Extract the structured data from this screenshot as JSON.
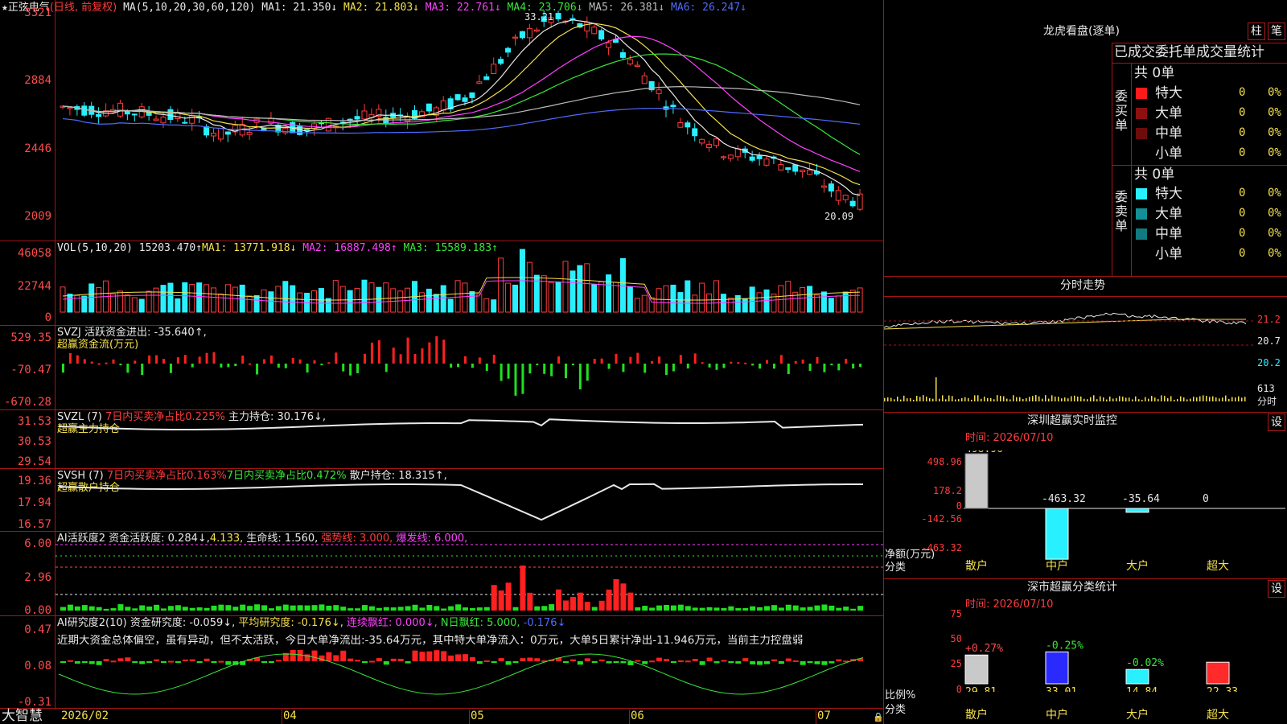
{
  "main": {
    "stock_name": "正弦电气",
    "period": "(日线, 前复权)",
    "ma_label": "MA(5,10,20,30,60,120)",
    "ma": [
      {
        "name": "MA1:",
        "value": "21.350↓",
        "color": "#e8e8e8"
      },
      {
        "name": "MA2:",
        "value": "21.803↓",
        "color": "#f5e04a"
      },
      {
        "name": "MA3:",
        "value": "22.761↓",
        "color": "#ff40ff"
      },
      {
        "name": "MA4:",
        "value": "23.706↓",
        "color": "#39e639"
      },
      {
        "name": "MA5:",
        "value": "26.381↓",
        "color": "#bbbbbb"
      },
      {
        "name": "MA6:",
        "value": "26.247↓",
        "color": "#4f6bff"
      }
    ],
    "y_ticks": [
      "3321",
      "2884",
      "2446",
      "2009"
    ],
    "high_label": "33.21",
    "low_label": "20.09"
  },
  "vol": {
    "label": "VOL(5,10,20)",
    "value": "15203.470↑",
    "ma1": "MA1: 13771.918↓",
    "ma2": "MA2: 16887.498↑",
    "ma3": "MA3: 15589.183↑",
    "y_ticks": [
      "46058",
      "22744",
      "0"
    ]
  },
  "svzj": {
    "label": "SVZJ  活跃资金进出: -35.640↑,",
    "sub": "超赢资金流(万元)",
    "y_ticks": [
      "529.35",
      "-70.47",
      "-670.28"
    ]
  },
  "svzl": {
    "label": "SVZL (7)",
    "ratio": "7日内买卖净占比0.225%",
    "hold": "主力持仓: 30.176↓,",
    "sub": "超赢主力持仓",
    "y_ticks": [
      "31.53",
      "30.53",
      "29.54"
    ]
  },
  "svsh": {
    "label": "SVSH (7)",
    "ratio1": "7日内买卖净占比0.163%",
    "ratio2": "7日内买卖净占比0.472%",
    "hold": "散户持仓: 18.315↑,",
    "sub": "超赢散户持仓",
    "y_ticks": [
      "19.36",
      "17.94",
      "16.57"
    ]
  },
  "ai1": {
    "label": "AI活跃度2",
    "v1": "资金活跃度: 0.284↓,",
    "v2": "4.133,",
    "v3": "生命线: 1.560,",
    "v4": "强势线: 3.000,",
    "v5": "爆发线: 6.000,",
    "y_ticks": [
      "6.00",
      "2.96",
      "0.00"
    ]
  },
  "ai2": {
    "label": "AI研究度2(10)",
    "v1": "资金研究度: -0.059↓,",
    "v2": "平均研究度: -0.176↓,",
    "v3": "连续飘红: 0.000↓,",
    "v4": "N日飘红: 5.000,",
    "v5": "-0.176↓",
    "comment": "近期大资金总体偏空，虽有异动，但不太活跃，今日大单净流出:-35.64万元，其中特大单净流入：0万元，大单5日累计净出-11.946万元，当前主力控盘弱",
    "y_ticks": [
      "0.47",
      "0.08",
      "-0.31"
    ]
  },
  "xaxis": {
    "brand": "大智慧",
    "labels": [
      "2026/02",
      "04",
      "05",
      "06",
      "07"
    ]
  },
  "right": {
    "dragon_title": "龙虎看盘(逐单)",
    "btn_zhu": "柱",
    "btn_bi": "笔",
    "tabs_title": "已成交委托单成交量统计",
    "buy_side": "委买单",
    "sell_side": "委卖单",
    "buy_total": "共 0单",
    "sell_total": "共 0单",
    "buy_rows": [
      {
        "label": "特大",
        "count": "0",
        "pct": "0%",
        "color": "#ff1a1a"
      },
      {
        "label": "大单",
        "count": "0",
        "pct": "0%",
        "color": "#8c1010"
      },
      {
        "label": "中单",
        "count": "0",
        "pct": "0%",
        "color": "#6e0c0c"
      },
      {
        "label": "小单",
        "count": "0",
        "pct": "0%",
        "color": "#000000"
      }
    ],
    "sell_rows": [
      {
        "label": "特大",
        "count": "0",
        "pct": "0%",
        "color": "#29f0ff"
      },
      {
        "label": "大单",
        "count": "0",
        "pct": "0%",
        "color": "#138f96"
      },
      {
        "label": "中单",
        "count": "0",
        "pct": "0%",
        "color": "#0f7a80"
      },
      {
        "label": "小单",
        "count": "0",
        "pct": "0%",
        "color": "#000000"
      }
    ],
    "intraday_title": "分时走势",
    "intraday_ticks": [
      "21.2",
      "20.7",
      "20.2",
      "613",
      "分时"
    ],
    "sz_title": "深圳超赢实时监控",
    "sz_btn": "设",
    "sz_time": "时间: 2026/07/10",
    "sz_yticks": [
      "498.96",
      "178.2",
      "0",
      "-142.56",
      "-463.32"
    ],
    "sz_values": [
      "498.96",
      "-463.32",
      "-35.64",
      "0"
    ],
    "sz_unit1": "净额(万元)",
    "sz_unit2": "分类",
    "categories": [
      "散户",
      "中户",
      "大户",
      "超大"
    ],
    "cls_title": "深市超赢分类统计",
    "cls_btn": "设",
    "cls_time": "时间: 2026/07/10",
    "cls_yticks": [
      "75",
      "50",
      "25",
      "0"
    ],
    "cls_pct": [
      "+0.27%",
      "-0.25%",
      "-0.02%"
    ],
    "cls_vals": [
      "29.81",
      "33.01",
      "14.84",
      "22.33"
    ],
    "cls_unit1": "比例%",
    "cls_unit2": "分类"
  }
}
